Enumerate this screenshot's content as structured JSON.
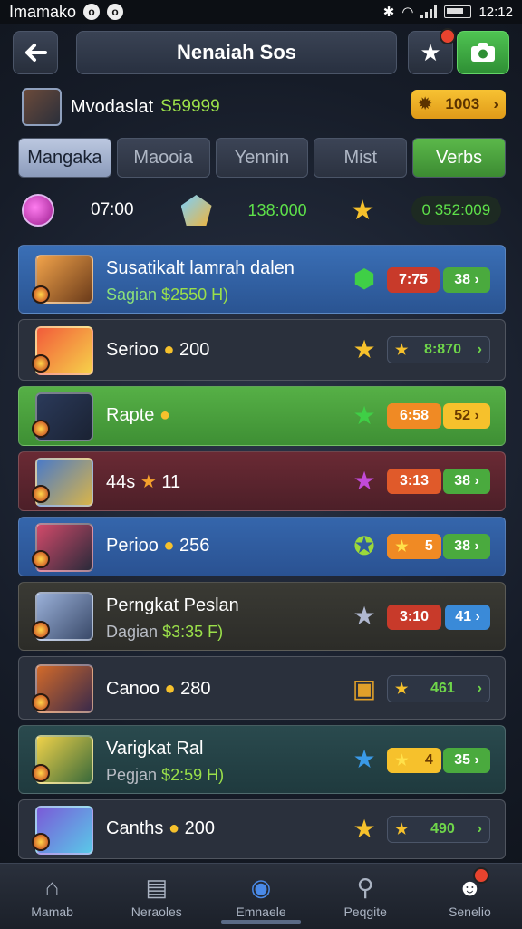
{
  "status_bar": {
    "carrier": "Imamako",
    "time": "12:12",
    "battery_label": "12"
  },
  "header": {
    "title": "Nenaiah Sos"
  },
  "profile": {
    "name": "Mvodaslat",
    "money": "S59999",
    "coins": "1003"
  },
  "tabs": [
    {
      "label": "Mangaka",
      "state": "active"
    },
    {
      "label": "Maooia",
      "state": "normal"
    },
    {
      "label": "Yennin",
      "state": "normal"
    },
    {
      "label": "Mist",
      "state": "normal"
    },
    {
      "label": "Verbs",
      "state": "green"
    }
  ],
  "stats": {
    "time": "07:00",
    "value_a": "138:000",
    "value_b": "0 352:009"
  },
  "rows": [
    {
      "name": "Susatikalt lamrah dalen",
      "sub_prefix": "Sagian",
      "sub_amount": "$2550 H)",
      "pill_a": "7:75",
      "pill_b": "38",
      "icon": "green-gem-icon"
    },
    {
      "name": "Serioo",
      "coin_value": "200",
      "wide_value": "8:870",
      "icon": "star-icon"
    },
    {
      "name": "Rapte",
      "pill_a": "6:58",
      "pill_b": "52",
      "icon": "green-star-icon"
    },
    {
      "name": "44s",
      "coin_value": "11",
      "pill_a": "3:13",
      "pill_b": "38",
      "icon": "purple-star-icon"
    },
    {
      "name": "Perioo",
      "coin_value": "256",
      "pill_a": "5",
      "pill_b": "38",
      "icon": "gold-coin-icon"
    },
    {
      "name": "Perngkat Peslan",
      "sub_prefix": "Dagian",
      "sub_amount": "$3:35 F)",
      "pill_a": "3:10",
      "pill_b": "41",
      "icon": "silver-star-icon"
    },
    {
      "name": "Canoo",
      "coin_value": "280",
      "wide_value": "461",
      "icon": "chest-icon"
    },
    {
      "name": "Varigkat Ral",
      "sub_prefix": "Pegjan",
      "sub_amount": "$2:59 H)",
      "pill_a": "4",
      "pill_b": "35",
      "icon": "blue-star-icon"
    },
    {
      "name": "Canths",
      "coin_value": "200",
      "wide_value": "490",
      "icon": "star-icon"
    }
  ],
  "nav": [
    {
      "label": "Mamab",
      "icon": "home-icon"
    },
    {
      "label": "Neraoles",
      "icon": "cards-icon"
    },
    {
      "label": "Emnaele",
      "icon": "shield-icon"
    },
    {
      "label": "Peqgite",
      "icon": "search-icon"
    },
    {
      "label": "Senelio",
      "icon": "skull-icon"
    }
  ],
  "colors": {
    "green": "#4caf3c",
    "gold": "#f6c12c",
    "red_pill": "#d9432e",
    "orange_pill": "#f08a24",
    "blue_row": "#2f5a98"
  }
}
